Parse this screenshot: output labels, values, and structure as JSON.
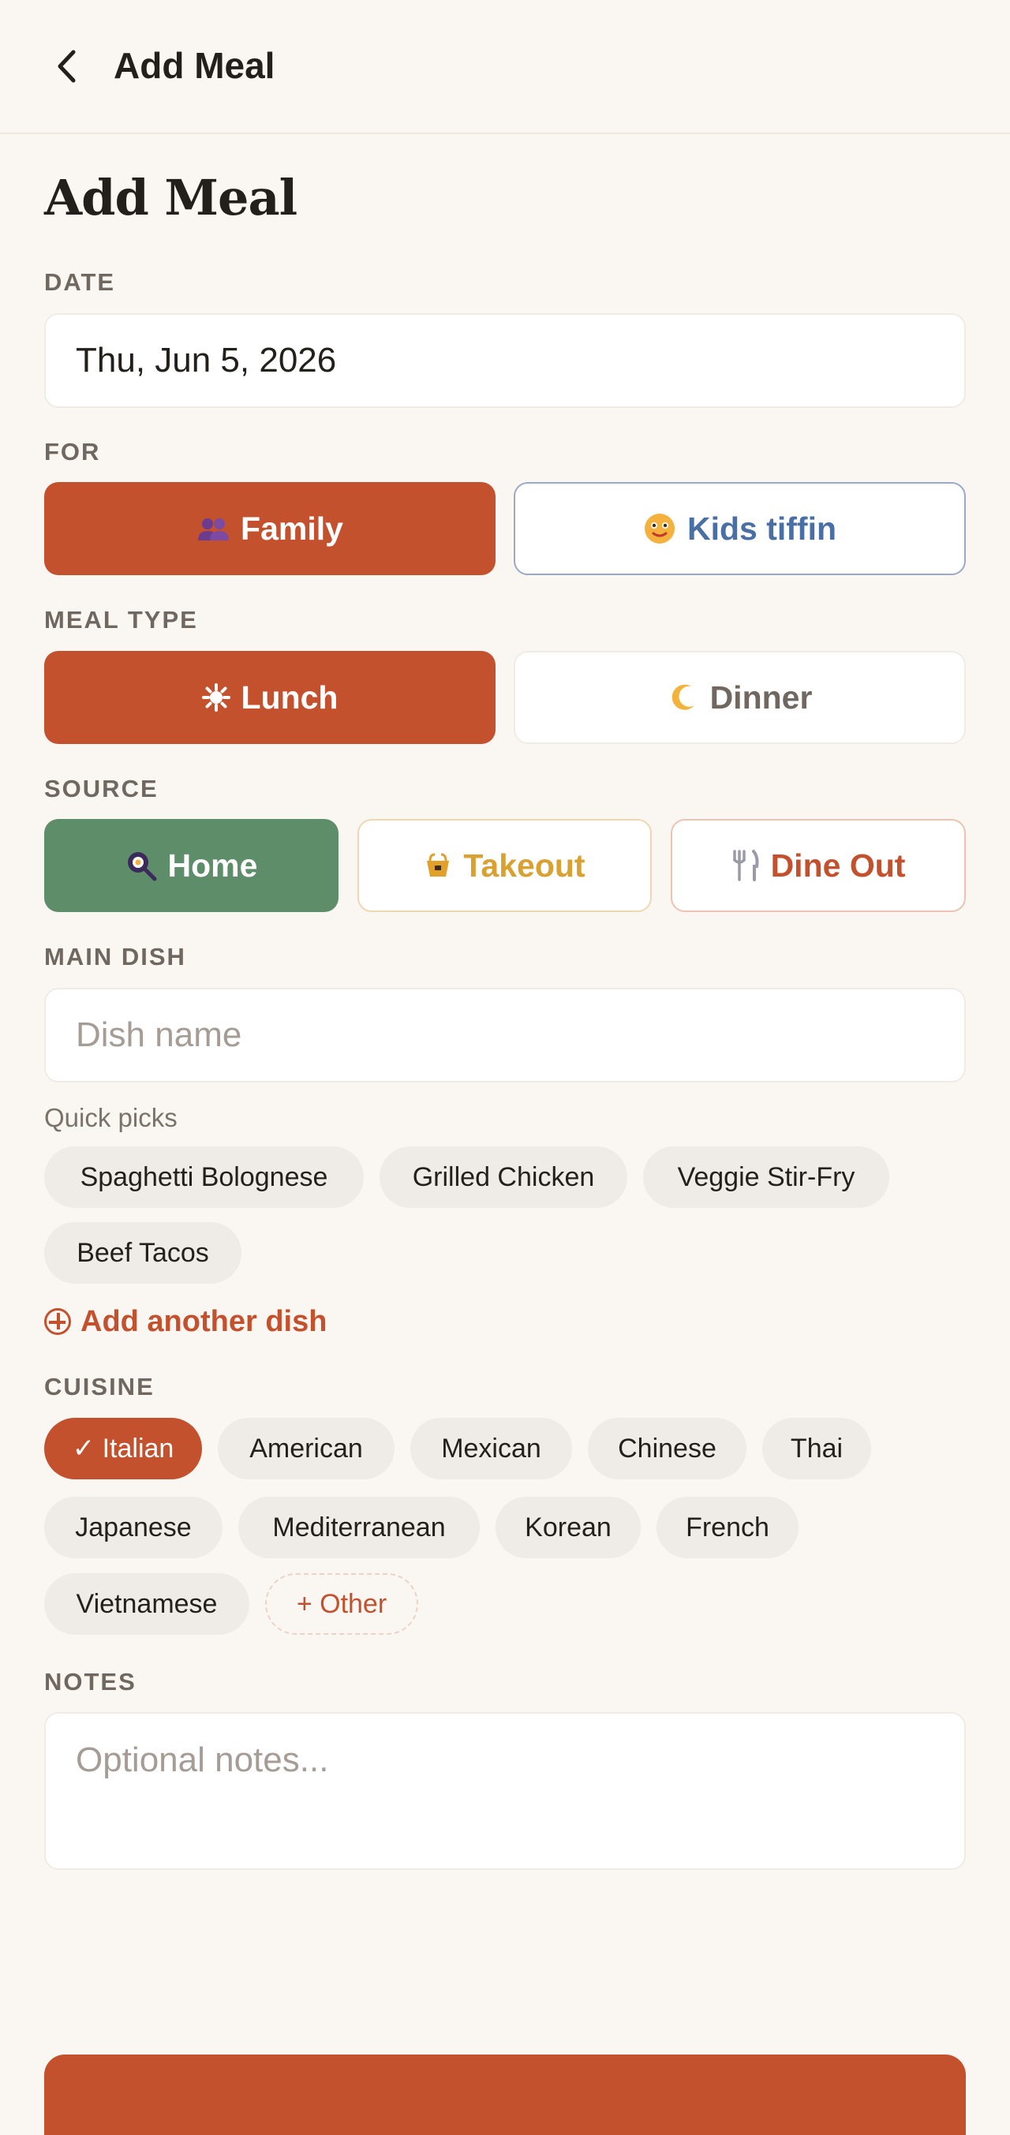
{
  "header": {
    "title": "Add Meal"
  },
  "page": {
    "title": "Add Meal"
  },
  "date": {
    "label": "DATE",
    "value": "Thu, Jun 5, 2026"
  },
  "for": {
    "label": "FOR",
    "options": [
      {
        "label": "Family",
        "icon": "family-icon",
        "selected": true
      },
      {
        "label": "Kids tiffin",
        "icon": "smiley-icon",
        "selected": false
      }
    ]
  },
  "meal_type": {
    "label": "MEAL TYPE",
    "options": [
      {
        "label": "Lunch",
        "icon": "sun-icon",
        "selected": true
      },
      {
        "label": "Dinner",
        "icon": "moon-icon",
        "selected": false
      }
    ]
  },
  "source": {
    "label": "SOURCE",
    "options": [
      {
        "label": "Home",
        "icon": "frying-pan-icon",
        "selected": true
      },
      {
        "label": "Takeout",
        "icon": "takeout-icon",
        "selected": false
      },
      {
        "label": "Dine Out",
        "icon": "fork-knife-icon",
        "selected": false
      }
    ]
  },
  "main_dish": {
    "label": "MAIN DISH",
    "placeholder": "Dish name",
    "quick_picks_label": "Quick picks",
    "quick_picks": [
      "Spaghetti Bolognese",
      "Grilled Chicken",
      "Veggie Stir-Fry",
      "Beef Tacos"
    ],
    "add_another": "Add another dish"
  },
  "cuisine": {
    "label": "CUISINE",
    "selected": "✓ Italian",
    "options": [
      "American",
      "Mexican",
      "Chinese",
      "Thai",
      "Japanese",
      "Mediterranean",
      "Korean",
      "French",
      "Vietnamese"
    ],
    "other": "+ Other"
  },
  "notes": {
    "label": "NOTES",
    "placeholder": "Optional notes..."
  },
  "colors": {
    "accent": "#c4512e",
    "home_green": "#5e8d6a",
    "kids_blue": "#4a6fa5",
    "takeout_gold": "#d9a032",
    "background": "#faf7f3"
  }
}
